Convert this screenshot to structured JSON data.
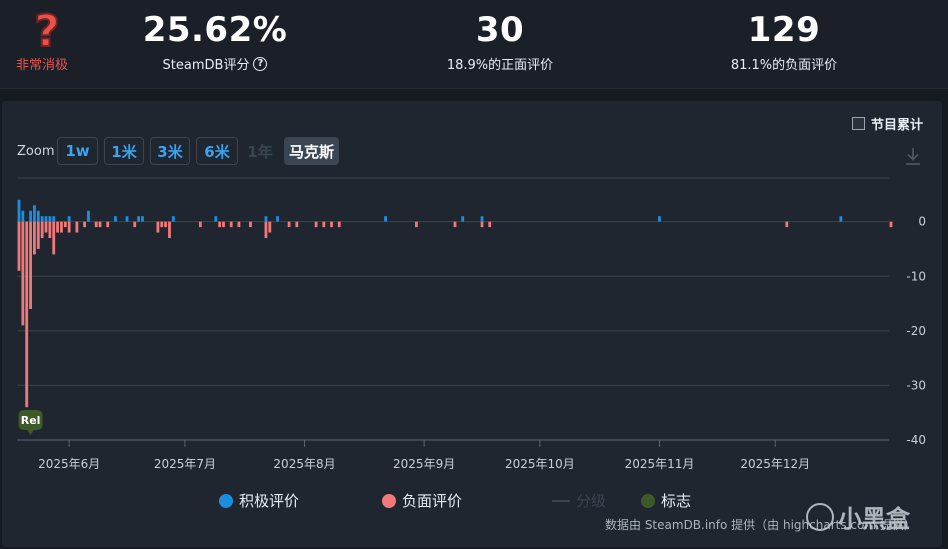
{
  "header": {
    "rating_label": "非常消极",
    "score": "25.62%",
    "score_label": "SteamDB评分",
    "help_glyph": "?",
    "positive_count": "30",
    "positive_label": "18.9%的正面评价",
    "negative_count": "129",
    "negative_label": "81.1%的负面评价"
  },
  "controls": {
    "zoom_label": "Zoom",
    "zoom_buttons": [
      "1w",
      "1米",
      "3米",
      "6米",
      "1年",
      "马克斯"
    ],
    "cumulative_label": "节目累计"
  },
  "legend": {
    "positive": "积极评价",
    "negative": "负面评价",
    "rating": "分级",
    "markers": "标志"
  },
  "credit": "数据由 SteamDB.info 提供（由 highcharts.com 提供）",
  "watermark": "小黑盒",
  "colors": {
    "positive": "#1b8ee0",
    "negative": "#f07a7a",
    "marker": "#3d5a28",
    "bad_rating": "#e5534b"
  },
  "chart_data": {
    "type": "bar",
    "x_axis_type": "datetime",
    "xlim": [
      "2025-05-19",
      "2025-12-31"
    ],
    "ylim": [
      -40,
      8
    ],
    "yticks": [
      0,
      -10,
      -20,
      -30,
      -40
    ],
    "xticks": [
      {
        "date": "2025-06-01",
        "label": "2025年6月"
      },
      {
        "date": "2025-07-01",
        "label": "2025年7月"
      },
      {
        "date": "2025-08-01",
        "label": "2025年8月"
      },
      {
        "date": "2025-09-01",
        "label": "2025年9月"
      },
      {
        "date": "2025-10-01",
        "label": "2025年10月"
      },
      {
        "date": "2025-11-01",
        "label": "2025年11月"
      },
      {
        "date": "2025-12-01",
        "label": "2025年12月"
      }
    ],
    "series": [
      {
        "name": "积极评价",
        "data": [
          [
            "2025-05-19",
            4
          ],
          [
            "2025-05-20",
            2
          ],
          [
            "2025-05-22",
            2
          ],
          [
            "2025-05-23",
            3
          ],
          [
            "2025-05-24",
            2
          ],
          [
            "2025-05-25",
            1
          ],
          [
            "2025-05-26",
            1
          ],
          [
            "2025-05-27",
            1
          ],
          [
            "2025-05-28",
            1
          ],
          [
            "2025-06-01",
            1
          ],
          [
            "2025-06-06",
            2
          ],
          [
            "2025-06-13",
            1
          ],
          [
            "2025-06-16",
            1
          ],
          [
            "2025-06-19",
            1
          ],
          [
            "2025-06-20",
            1
          ],
          [
            "2025-06-28",
            1
          ],
          [
            "2025-07-09",
            1
          ],
          [
            "2025-07-22",
            1
          ],
          [
            "2025-07-25",
            1
          ],
          [
            "2025-08-22",
            1
          ],
          [
            "2025-09-11",
            1
          ],
          [
            "2025-09-16",
            1
          ],
          [
            "2025-11-01",
            1
          ],
          [
            "2025-12-18",
            1
          ]
        ]
      },
      {
        "name": "负面评价",
        "data": [
          [
            "2025-05-19",
            -9
          ],
          [
            "2025-05-20",
            -19
          ],
          [
            "2025-05-21",
            -34
          ],
          [
            "2025-05-22",
            -16
          ],
          [
            "2025-05-23",
            -6
          ],
          [
            "2025-05-24",
            -5
          ],
          [
            "2025-05-25",
            -3
          ],
          [
            "2025-05-26",
            -2
          ],
          [
            "2025-05-27",
            -3
          ],
          [
            "2025-05-28",
            -6
          ],
          [
            "2025-05-29",
            -2
          ],
          [
            "2025-05-30",
            -2
          ],
          [
            "2025-05-31",
            -1
          ],
          [
            "2025-06-01",
            -2
          ],
          [
            "2025-06-03",
            -2
          ],
          [
            "2025-06-05",
            -1
          ],
          [
            "2025-06-08",
            -1
          ],
          [
            "2025-06-09",
            -1
          ],
          [
            "2025-06-11",
            -1
          ],
          [
            "2025-06-18",
            -1
          ],
          [
            "2025-06-24",
            -2
          ],
          [
            "2025-06-25",
            -1
          ],
          [
            "2025-06-26",
            -1
          ],
          [
            "2025-06-27",
            -3
          ],
          [
            "2025-07-05",
            -1
          ],
          [
            "2025-07-10",
            -1
          ],
          [
            "2025-07-11",
            -1
          ],
          [
            "2025-07-13",
            -1
          ],
          [
            "2025-07-15",
            -1
          ],
          [
            "2025-07-18",
            -1
          ],
          [
            "2025-07-22",
            -3
          ],
          [
            "2025-07-23",
            -2
          ],
          [
            "2025-07-28",
            -1
          ],
          [
            "2025-07-30",
            -1
          ],
          [
            "2025-08-04",
            -1
          ],
          [
            "2025-08-06",
            -1
          ],
          [
            "2025-08-08",
            -1
          ],
          [
            "2025-08-10",
            -1
          ],
          [
            "2025-08-30",
            -1
          ],
          [
            "2025-09-09",
            -1
          ],
          [
            "2025-09-16",
            -1
          ],
          [
            "2025-09-18",
            -1
          ],
          [
            "2025-12-04",
            -1
          ],
          [
            "2025-12-31",
            -1
          ]
        ]
      }
    ],
    "markers": [
      {
        "date": "2025-05-22",
        "label": "Rel"
      }
    ],
    "grid": true
  }
}
